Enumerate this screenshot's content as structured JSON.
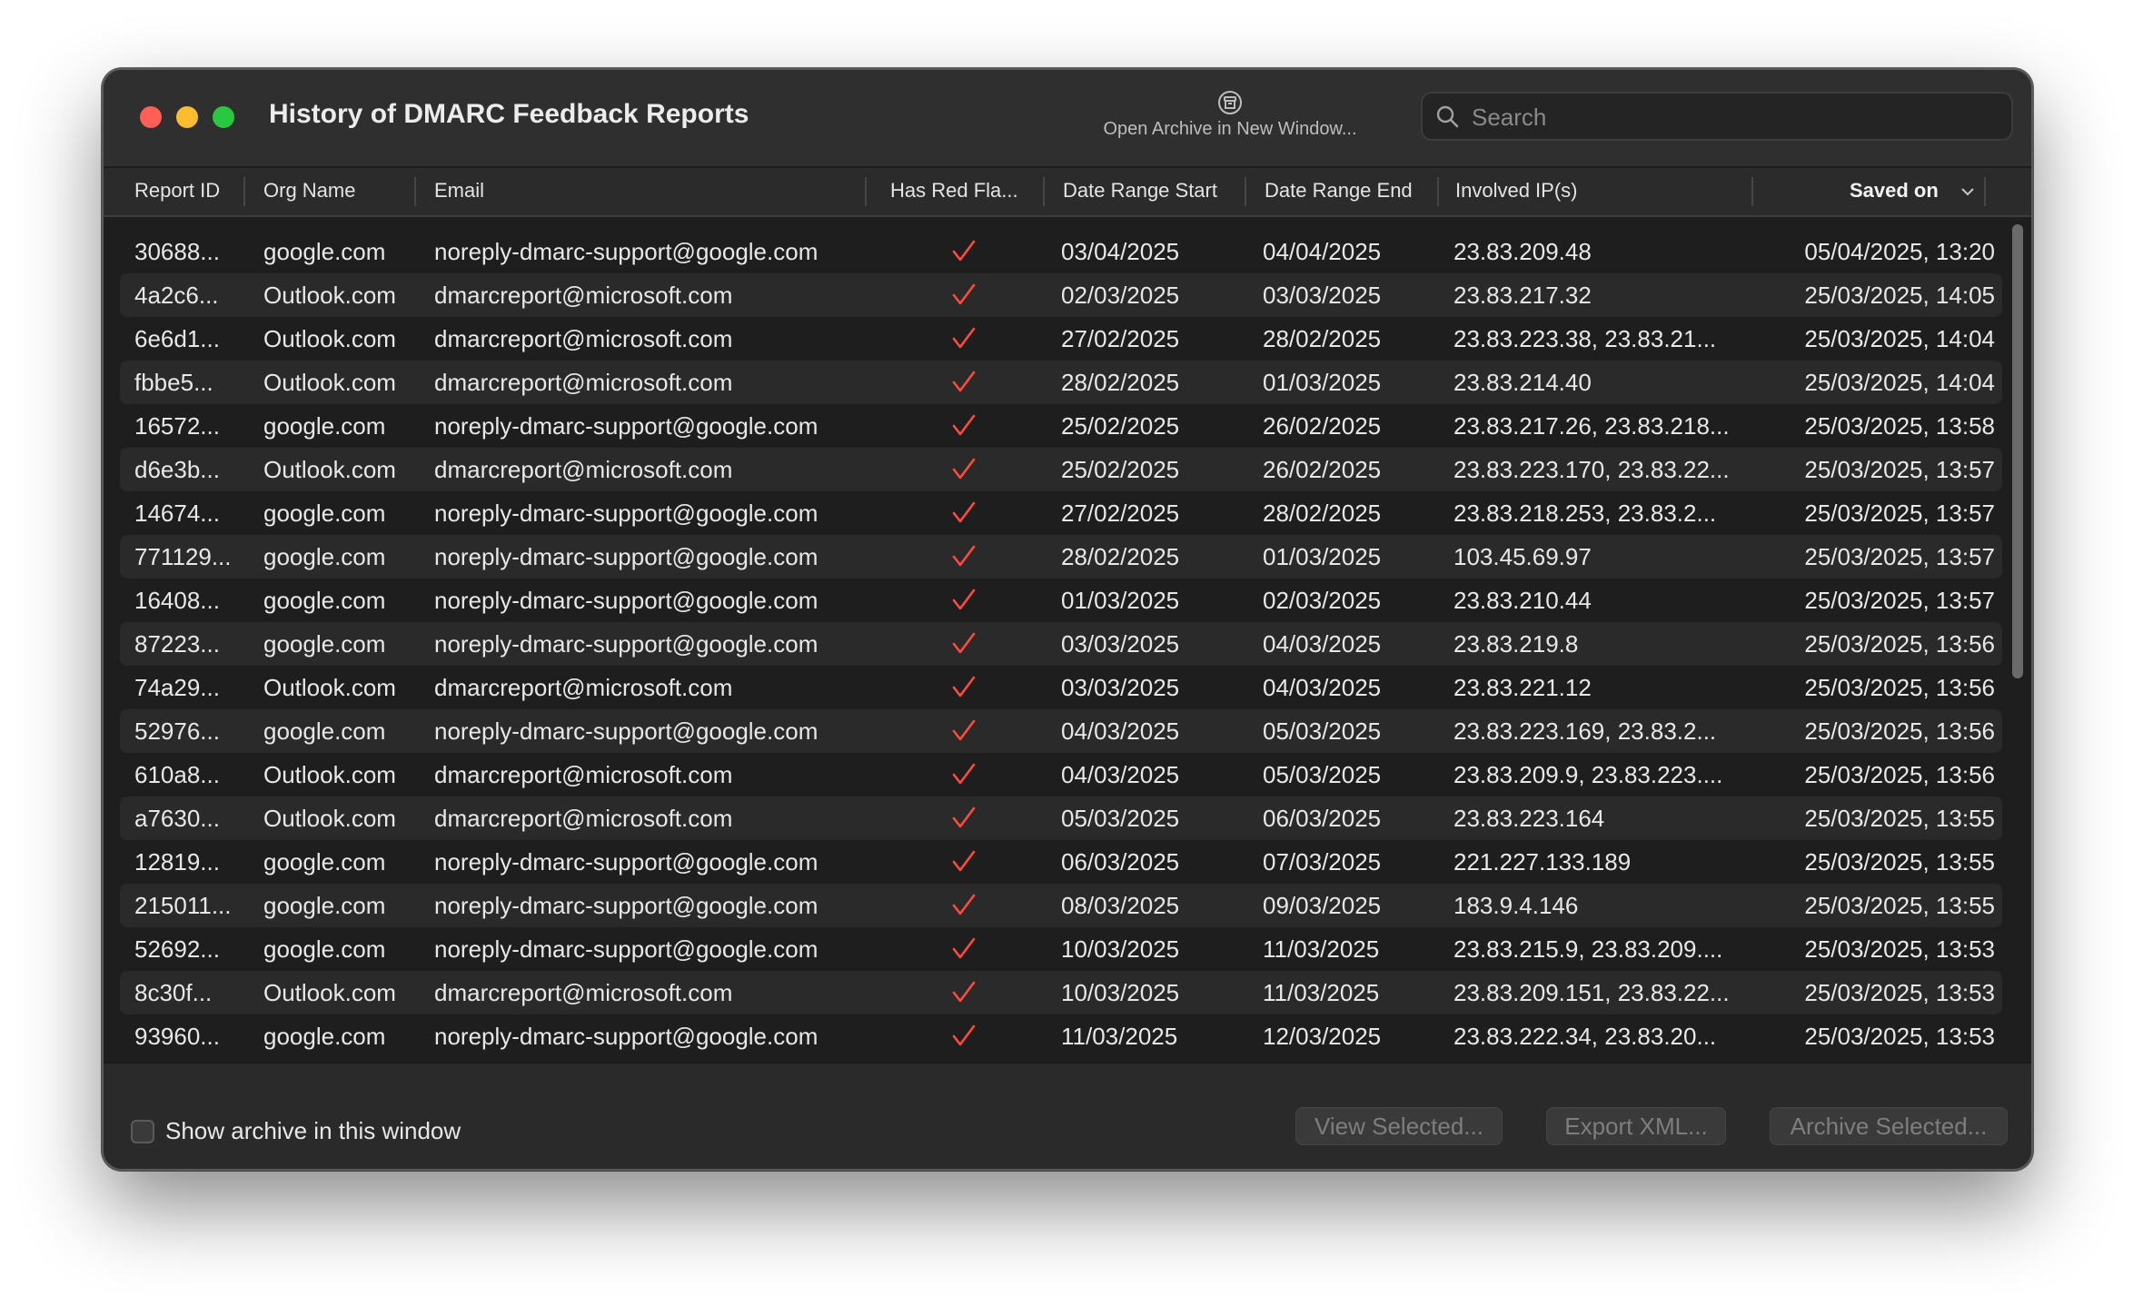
{
  "window": {
    "title": "History of DMARC Feedback Reports",
    "open_archive_label": "Open Archive in New Window...",
    "search_placeholder": "Search"
  },
  "columns": {
    "report_id": "Report ID",
    "org_name": "Org Name",
    "email": "Email",
    "has_red_flag": "Has Red Fla...",
    "date_start": "Date Range Start",
    "date_end": "Date Range End",
    "ips": "Involved IP(s)",
    "saved_on": "Saved on"
  },
  "rows": [
    {
      "id": "30688...",
      "org": "google.com",
      "email": "noreply-dmarc-support@google.com",
      "start": "03/04/2025",
      "end": "04/04/2025",
      "ips": "23.83.209.48",
      "saved": "05/04/2025, 13:20"
    },
    {
      "id": "4a2c6...",
      "org": "Outlook.com",
      "email": "dmarcreport@microsoft.com",
      "start": "02/03/2025",
      "end": "03/03/2025",
      "ips": "23.83.217.32",
      "saved": "25/03/2025, 14:05"
    },
    {
      "id": "6e6d1...",
      "org": "Outlook.com",
      "email": "dmarcreport@microsoft.com",
      "start": "27/02/2025",
      "end": "28/02/2025",
      "ips": "23.83.223.38, 23.83.21...",
      "saved": "25/03/2025, 14:04"
    },
    {
      "id": "fbbe5...",
      "org": "Outlook.com",
      "email": "dmarcreport@microsoft.com",
      "start": "28/02/2025",
      "end": "01/03/2025",
      "ips": "23.83.214.40",
      "saved": "25/03/2025, 14:04"
    },
    {
      "id": "16572...",
      "org": "google.com",
      "email": "noreply-dmarc-support@google.com",
      "start": "25/02/2025",
      "end": "26/02/2025",
      "ips": "23.83.217.26, 23.83.218...",
      "saved": "25/03/2025, 13:58"
    },
    {
      "id": "d6e3b...",
      "org": "Outlook.com",
      "email": "dmarcreport@microsoft.com",
      "start": "25/02/2025",
      "end": "26/02/2025",
      "ips": "23.83.223.170, 23.83.22...",
      "saved": "25/03/2025, 13:57"
    },
    {
      "id": "14674...",
      "org": "google.com",
      "email": "noreply-dmarc-support@google.com",
      "start": "27/02/2025",
      "end": "28/02/2025",
      "ips": "23.83.218.253, 23.83.2...",
      "saved": "25/03/2025, 13:57"
    },
    {
      "id": "771129...",
      "org": "google.com",
      "email": "noreply-dmarc-support@google.com",
      "start": "28/02/2025",
      "end": "01/03/2025",
      "ips": "103.45.69.97",
      "saved": "25/03/2025, 13:57"
    },
    {
      "id": "16408...",
      "org": "google.com",
      "email": "noreply-dmarc-support@google.com",
      "start": "01/03/2025",
      "end": "02/03/2025",
      "ips": "23.83.210.44",
      "saved": "25/03/2025, 13:57"
    },
    {
      "id": "87223...",
      "org": "google.com",
      "email": "noreply-dmarc-support@google.com",
      "start": "03/03/2025",
      "end": "04/03/2025",
      "ips": "23.83.219.8",
      "saved": "25/03/2025, 13:56"
    },
    {
      "id": "74a29...",
      "org": "Outlook.com",
      "email": "dmarcreport@microsoft.com",
      "start": "03/03/2025",
      "end": "04/03/2025",
      "ips": "23.83.221.12",
      "saved": "25/03/2025, 13:56"
    },
    {
      "id": "52976...",
      "org": "google.com",
      "email": "noreply-dmarc-support@google.com",
      "start": "04/03/2025",
      "end": "05/03/2025",
      "ips": "23.83.223.169, 23.83.2...",
      "saved": "25/03/2025, 13:56"
    },
    {
      "id": "610a8...",
      "org": "Outlook.com",
      "email": "dmarcreport@microsoft.com",
      "start": "04/03/2025",
      "end": "05/03/2025",
      "ips": "23.83.209.9, 23.83.223....",
      "saved": "25/03/2025, 13:56"
    },
    {
      "id": "a7630...",
      "org": "Outlook.com",
      "email": "dmarcreport@microsoft.com",
      "start": "05/03/2025",
      "end": "06/03/2025",
      "ips": "23.83.223.164",
      "saved": "25/03/2025, 13:55"
    },
    {
      "id": "12819...",
      "org": "google.com",
      "email": "noreply-dmarc-support@google.com",
      "start": "06/03/2025",
      "end": "07/03/2025",
      "ips": "221.227.133.189",
      "saved": "25/03/2025, 13:55"
    },
    {
      "id": "215011...",
      "org": "google.com",
      "email": "noreply-dmarc-support@google.com",
      "start": "08/03/2025",
      "end": "09/03/2025",
      "ips": "183.9.4.146",
      "saved": "25/03/2025, 13:55"
    },
    {
      "id": "52692...",
      "org": "google.com",
      "email": "noreply-dmarc-support@google.com",
      "start": "10/03/2025",
      "end": "11/03/2025",
      "ips": "23.83.215.9, 23.83.209....",
      "saved": "25/03/2025, 13:53"
    },
    {
      "id": "8c30f...",
      "org": "Outlook.com",
      "email": "dmarcreport@microsoft.com",
      "start": "10/03/2025",
      "end": "11/03/2025",
      "ips": "23.83.209.151, 23.83.22...",
      "saved": "25/03/2025, 13:53"
    },
    {
      "id": "93960...",
      "org": "google.com",
      "email": "noreply-dmarc-support@google.com",
      "start": "11/03/2025",
      "end": "12/03/2025",
      "ips": "23.83.222.34, 23.83.20...",
      "saved": "25/03/2025, 13:53"
    }
  ],
  "footer": {
    "show_archive_label": "Show archive in this window",
    "view_selected": "View Selected...",
    "export_xml": "Export XML...",
    "archive_selected": "Archive Selected..."
  },
  "colors": {
    "check": "#ff4b3e",
    "window_bg": "#2a2a2a"
  },
  "icons": {
    "open_archive": "archive-box-icon",
    "search": "magnifier-icon",
    "red_flag": "checkmark-icon",
    "sort": "chevron-down-icon"
  }
}
